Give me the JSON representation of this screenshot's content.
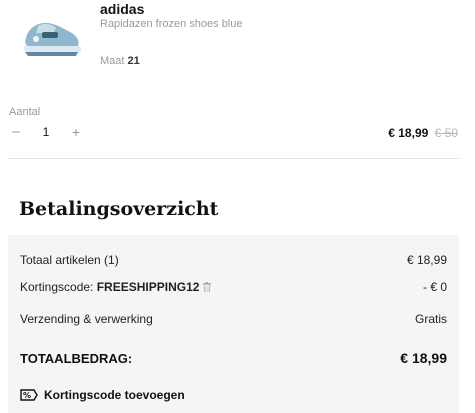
{
  "product": {
    "brand": "adidas",
    "name": "Rapidazen frozen shoes blue",
    "size_label": "Maat",
    "size_value": "21"
  },
  "quantity": {
    "label": "Aantal",
    "minus": "−",
    "value": "1",
    "plus": "+"
  },
  "price": {
    "current": "€ 18,99",
    "original": "€ 50"
  },
  "summary": {
    "title": "Betalingsoverzicht",
    "rows": [
      {
        "label": "Totaal artikelen (1)",
        "value": "€ 18,99"
      },
      {
        "label_prefix": "Kortingscode: ",
        "code": "FREESHIPPING12",
        "value": "- € 0"
      },
      {
        "label": "Verzending & verwerking",
        "value": "Gratis"
      }
    ],
    "total_label": "TOTAALBEDRAG:",
    "total_value": "€ 18,99",
    "add_discount": "Kortingscode toevoegen"
  },
  "icons": {
    "product_image": "blue-kids-shoe-image",
    "remove_code": "trash-icon",
    "discount": "discount-tag-icon"
  },
  "colors": {
    "summary_background": "#f5f5f5",
    "shoe_blue": "#7fa9c4"
  }
}
